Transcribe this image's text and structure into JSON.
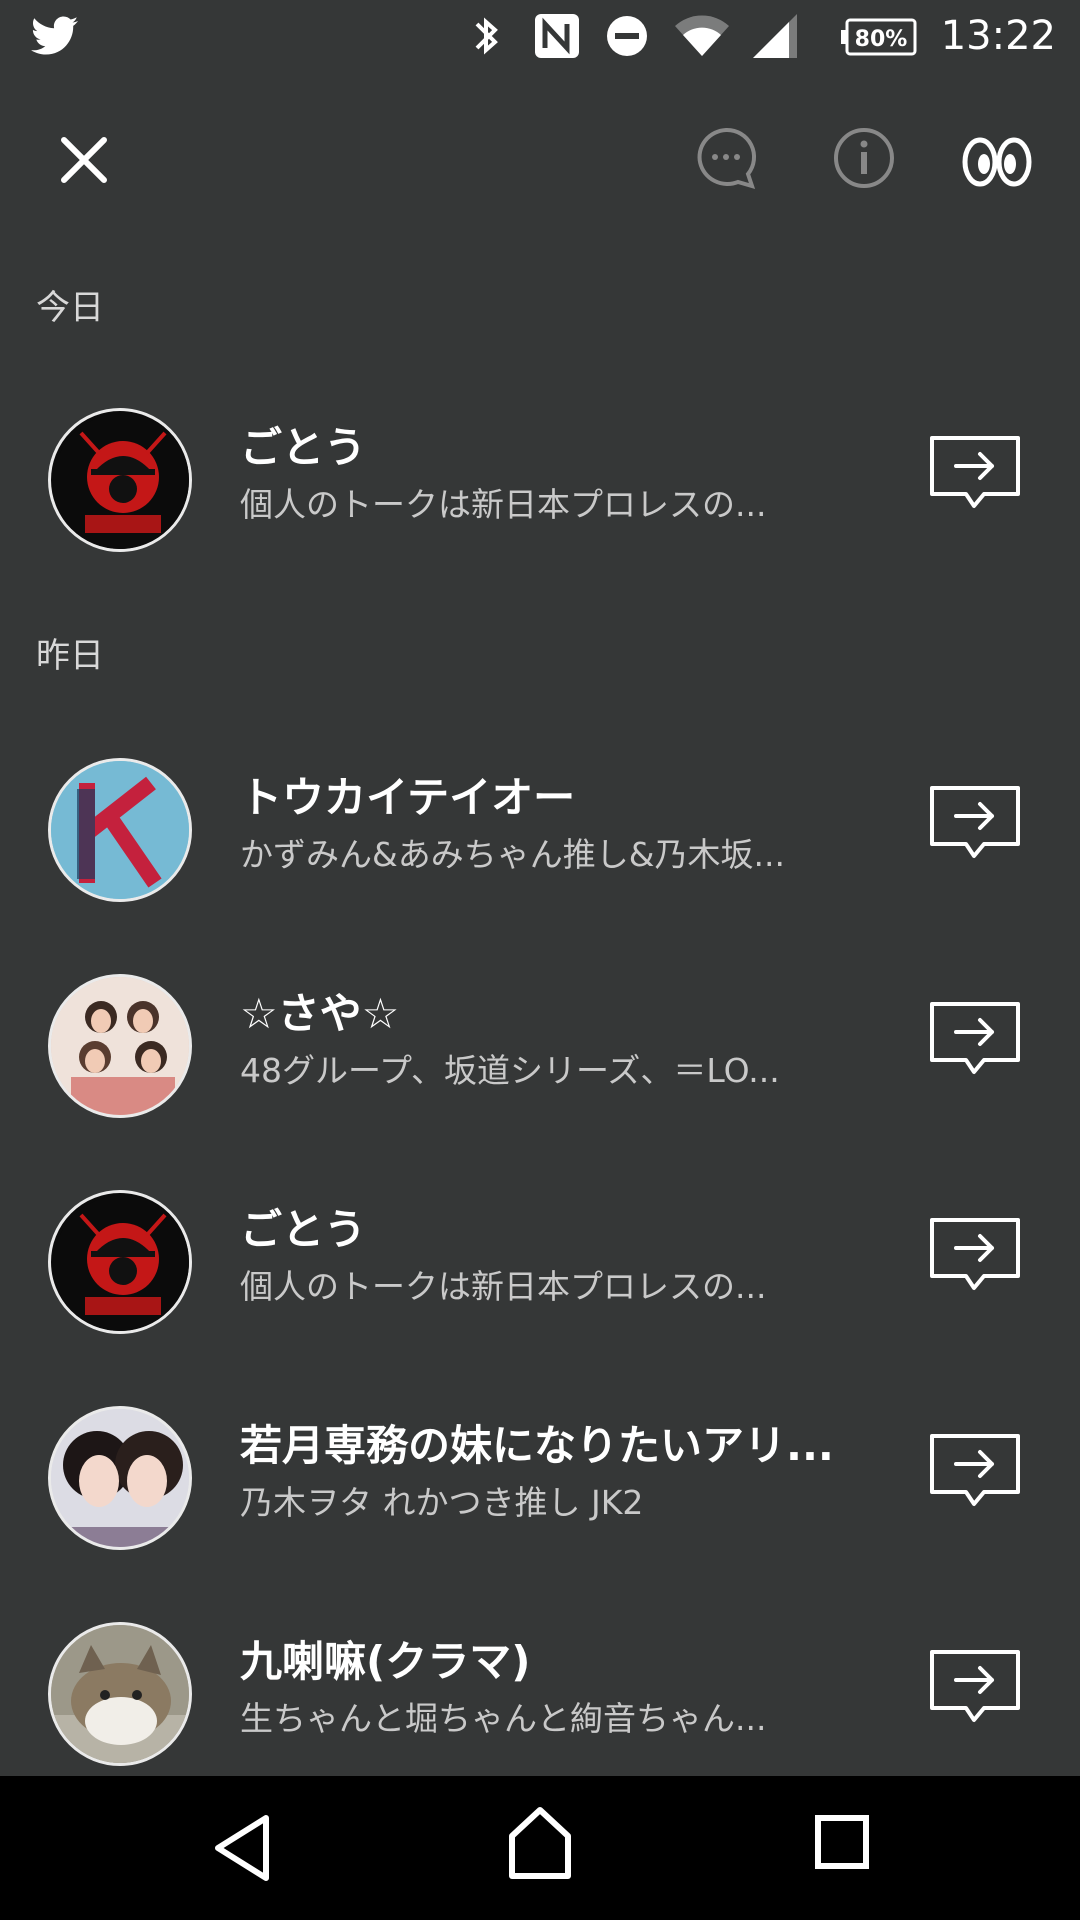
{
  "status_bar": {
    "time": "13:22",
    "battery": "80%",
    "icons": [
      "twitter-icon",
      "bluetooth-icon",
      "nfc-icon",
      "do-not-disturb-icon",
      "wifi-icon",
      "signal-icon",
      "battery-icon"
    ]
  },
  "toolbar": {
    "icons": [
      "close-icon",
      "chat-bubble-icon",
      "info-icon",
      "eyes-icon"
    ]
  },
  "sections": [
    {
      "label": "今日",
      "items": [
        {
          "name": "ごとう",
          "subtitle": "個人のトークは新日本プロレスの..."
        }
      ]
    },
    {
      "label": "昨日",
      "items": [
        {
          "name": "トウカイテイオー",
          "subtitle": "かずみん&あみちゃん推し&乃木坂..."
        },
        {
          "name": "☆さや☆",
          "subtitle": "48グループ、坂道シリーズ、＝LO..."
        },
        {
          "name": "ごとう",
          "subtitle": "個人のトークは新日本プロレスの..."
        },
        {
          "name": "若月専務の妹になりたいアリ...",
          "subtitle": "乃木ヲタ  れかつき推し  JK2"
        },
        {
          "name": "九喇嘛(クラマ)",
          "subtitle": "生ちゃんと堀ちゃんと絢音ちゃん..."
        }
      ]
    }
  ],
  "nav_bar": {
    "icons": [
      "back-icon",
      "home-icon",
      "recent-apps-icon"
    ]
  },
  "colors": {
    "background": "#353737",
    "text_primary": "#ffffff",
    "text_secondary": "#c9c9c9",
    "nav_background": "#000000"
  }
}
